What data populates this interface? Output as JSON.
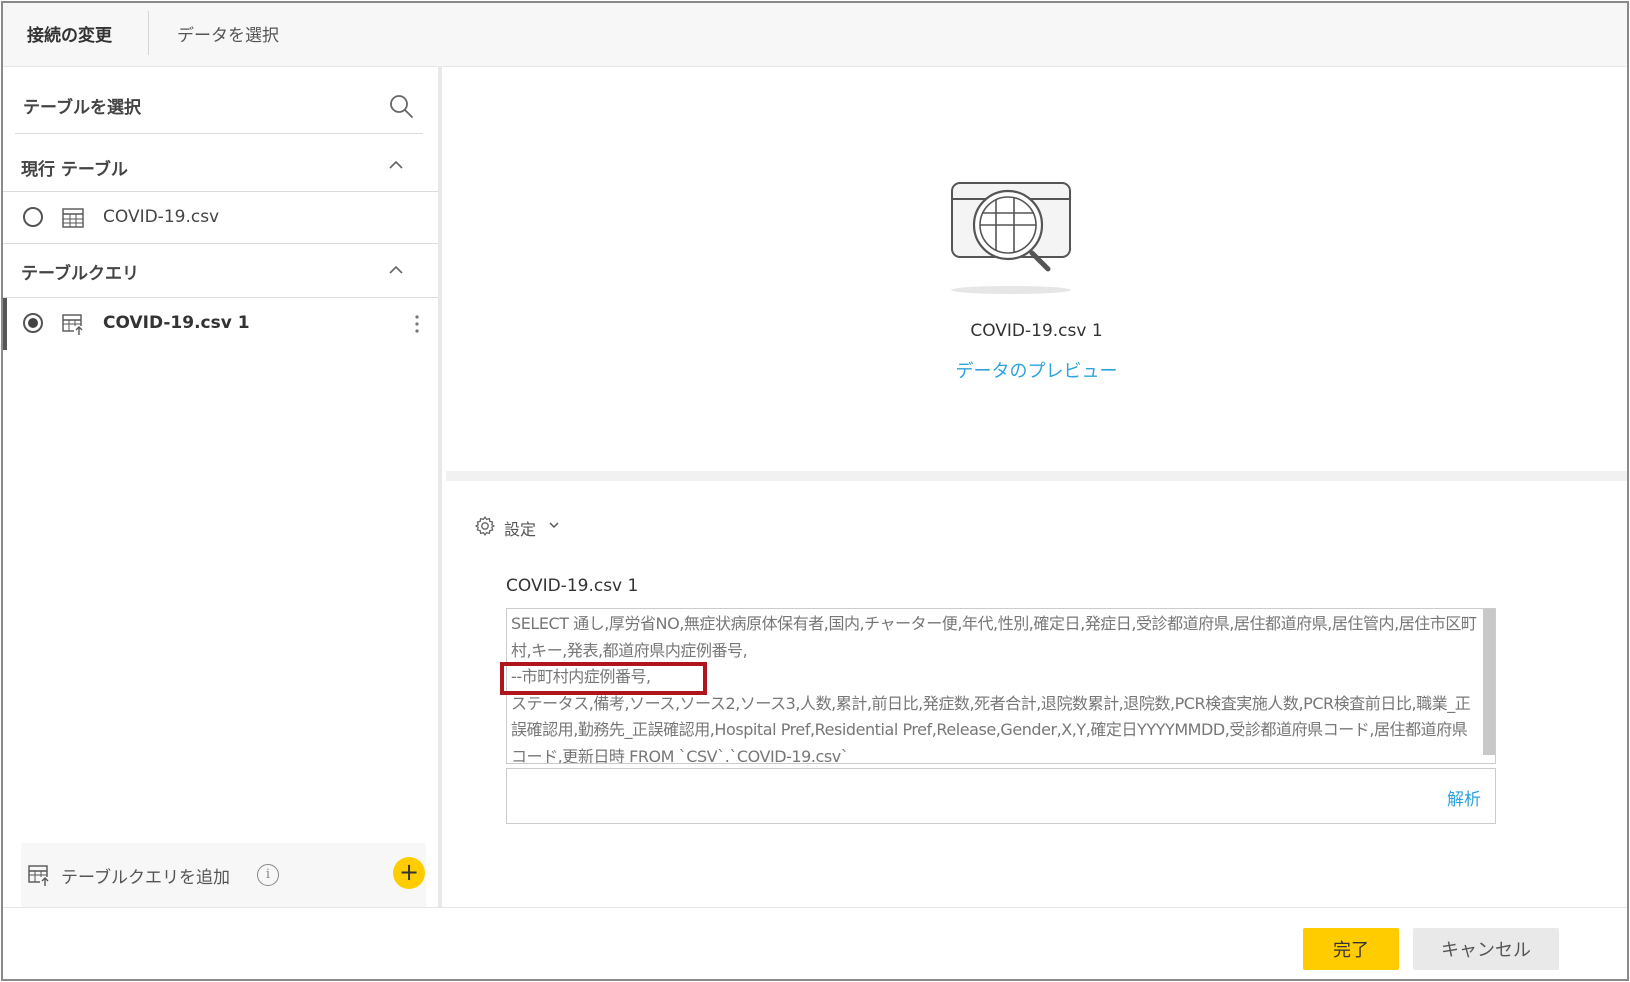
{
  "header": {
    "tab_active": "接続の変更",
    "tab_inactive": "データを選択"
  },
  "left_panel": {
    "select_title": "テーブルを選択",
    "search_icon": "search-icon",
    "current_section": {
      "title": "現行 テーブル",
      "items": [
        {
          "label": "COVID-19.csv",
          "selected": false
        }
      ]
    },
    "query_section": {
      "title": "テーブルクエリ",
      "items": [
        {
          "label": "COVID-19.csv 1",
          "selected": true
        }
      ]
    },
    "footer": {
      "add_label": "テーブルクエリを追加",
      "info_glyph": "i",
      "plus_glyph": "+"
    }
  },
  "preview": {
    "name": "COVID-19.csv 1",
    "link": "データのプレビュー"
  },
  "settings": {
    "toggle_label": "設定",
    "query_name": "COVID-19.csv 1",
    "sql_lines": [
      "SELECT 通し,厚労省NO,無症状病原体保有者,国内,チャーター便,年代,性別,確定日,発症日,受診都道府県,居住都道府県,居住管内,居住市区町村,キー,発表,都道府県内症例番号,",
      "--市町村内症例番号,",
      "ステータス,備考,ソース,ソース2,ソース3,人数,累計,前日比,発症数,死者合計,退院数累計,退院数,PCR検査実施人数,PCR検査前日比,職業_正誤確認用,勤務先_正誤確認用,Hospital Pref,Residential Pref,Release,Gender,X,Y,確定日YYYYMMDD,受診都道府県コード,居住都道府県コード,更新日時 FROM `CSV`.`COVID-19.csv`"
    ],
    "analyze_label": "解析"
  },
  "footer": {
    "done_label": "完了",
    "cancel_label": "キャンセル"
  },
  "colors": {
    "accent_yellow": "#ffcc00",
    "link_blue": "#2ea3dc",
    "highlight_red": "#b0141c"
  }
}
